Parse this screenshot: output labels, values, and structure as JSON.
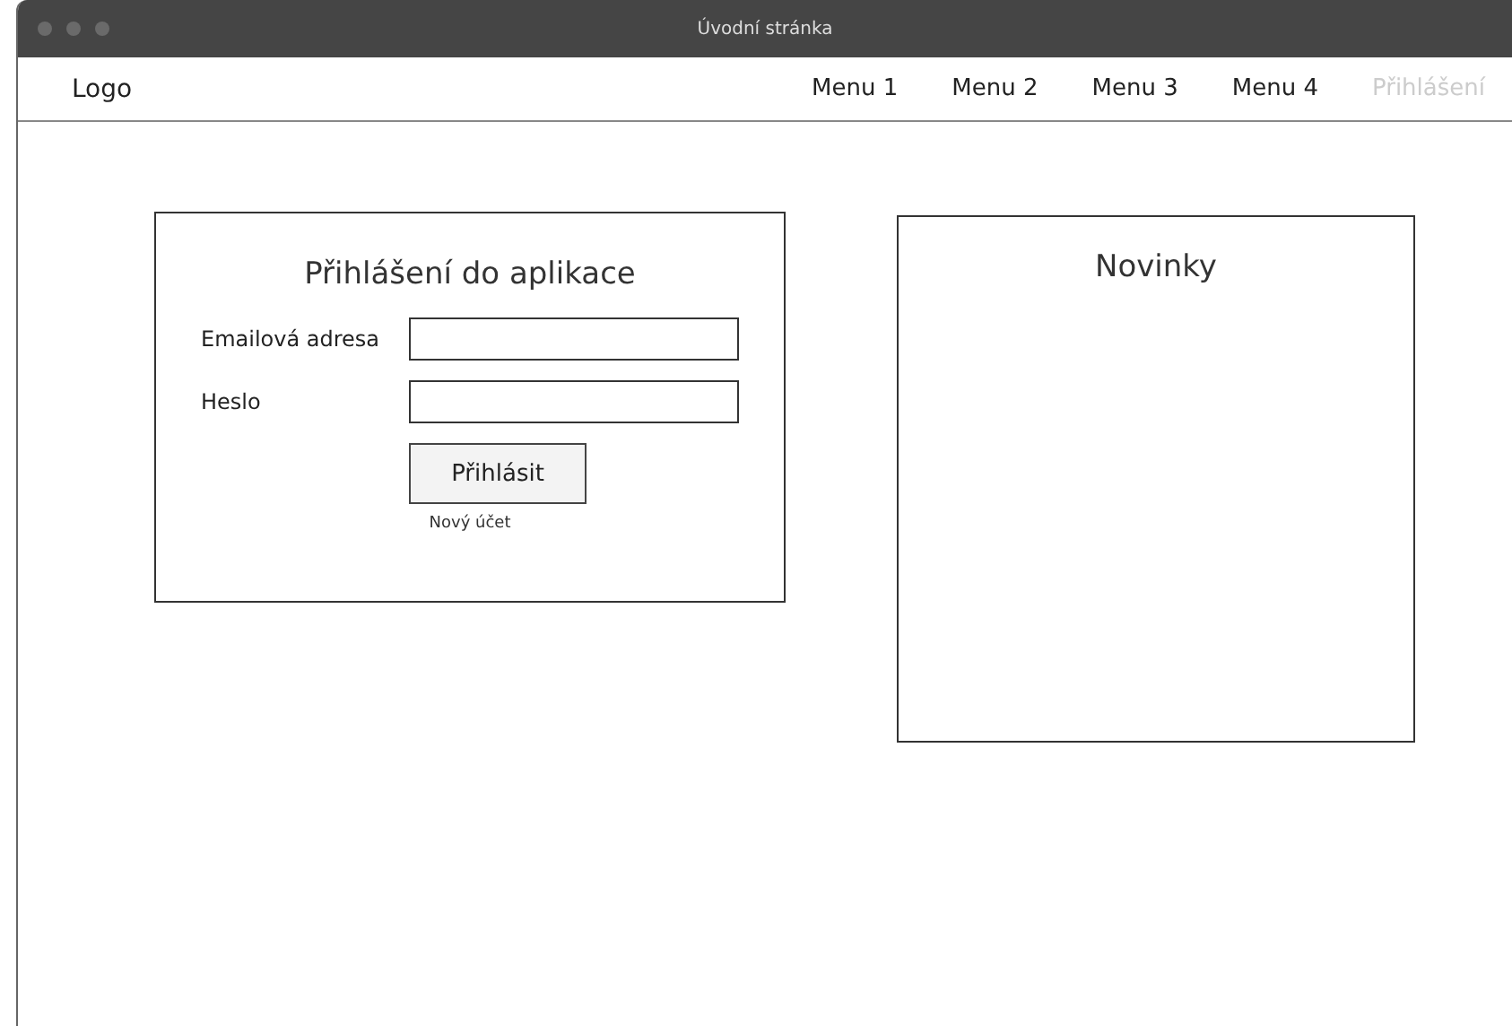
{
  "window": {
    "title": "Úvodní stránka"
  },
  "navbar": {
    "logo": "Logo",
    "items": [
      {
        "label": "Menu 1",
        "disabled": false
      },
      {
        "label": "Menu 2",
        "disabled": false
      },
      {
        "label": "Menu 3",
        "disabled": false
      },
      {
        "label": "Menu 4",
        "disabled": false
      },
      {
        "label": "Přihlášení",
        "disabled": true
      }
    ]
  },
  "login": {
    "title": "Přihlášení do aplikace",
    "fields": [
      {
        "label": "Emailová adresa"
      },
      {
        "label": "Heslo"
      }
    ],
    "button": "Přihlásit",
    "link": "Nový účet"
  },
  "news": {
    "title": "Novinky"
  }
}
